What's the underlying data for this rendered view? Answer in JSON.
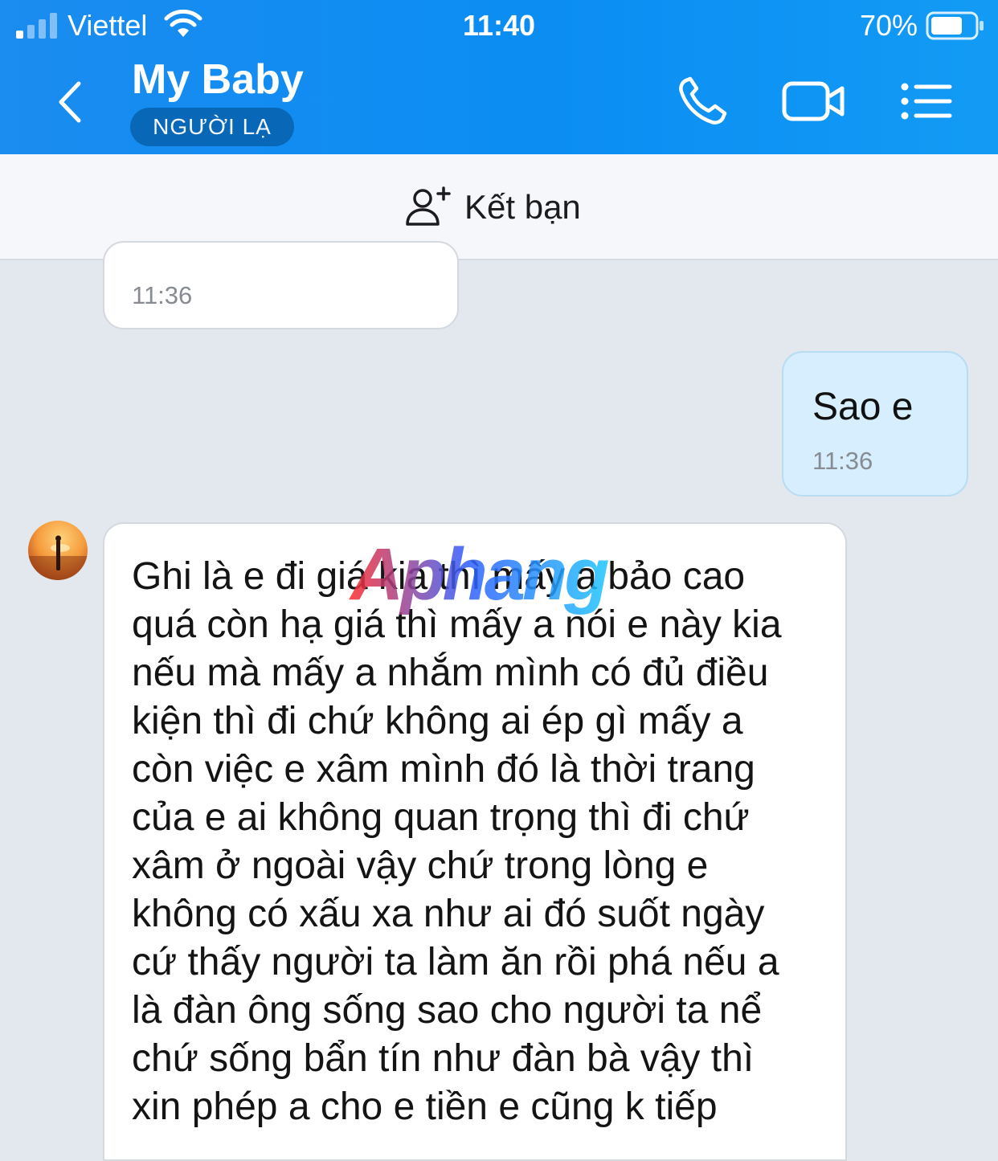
{
  "status_bar": {
    "carrier": "Viettel",
    "time": "11:40",
    "battery_percent": "70%"
  },
  "header": {
    "title": "My Baby",
    "badge": "NGƯỜI LẠ",
    "icons": [
      "back-chevron-icon",
      "phone-icon",
      "video-camera-icon",
      "menu-list-icon"
    ]
  },
  "add_friend": {
    "label": "Kết bạn",
    "icon": "add-user-icon"
  },
  "messages": {
    "previous": {
      "time": "11:36"
    },
    "mine": {
      "text": "Sao e",
      "time": "11:36"
    },
    "long": {
      "lines": [
        "Ghi là e đi giá kia thì mấy a bảo cao",
        "quá còn hạ giá thì mấy a nói e này kia",
        "nếu mà mấy a nhắm mình có đủ điều",
        "kiện thì đi chứ không ai ép gì mấy a",
        "còn việc e xâm mình đó là thời trang",
        "của e ai không quan trọng thì đi chứ",
        "xâm ở ngoài vậy chứ trong lòng e",
        "không có xấu xa như ai đó suốt ngày",
        "cứ thấy người ta làm ăn rồi phá nếu a",
        "là đàn ông sống sao cho người ta nể",
        "chứ sống bẩn tín như đàn bà vậy thì",
        "xin phép a cho e tiền e cũng k tiếp"
      ]
    }
  },
  "watermark": {
    "text": "Aphang"
  },
  "colors": {
    "header": "#0b8df2",
    "badge": "#0867b6",
    "chat_background": "#e3e7ee",
    "outgoing_bubble": "#d6eefd",
    "incoming_bubble": "#ffffff"
  }
}
